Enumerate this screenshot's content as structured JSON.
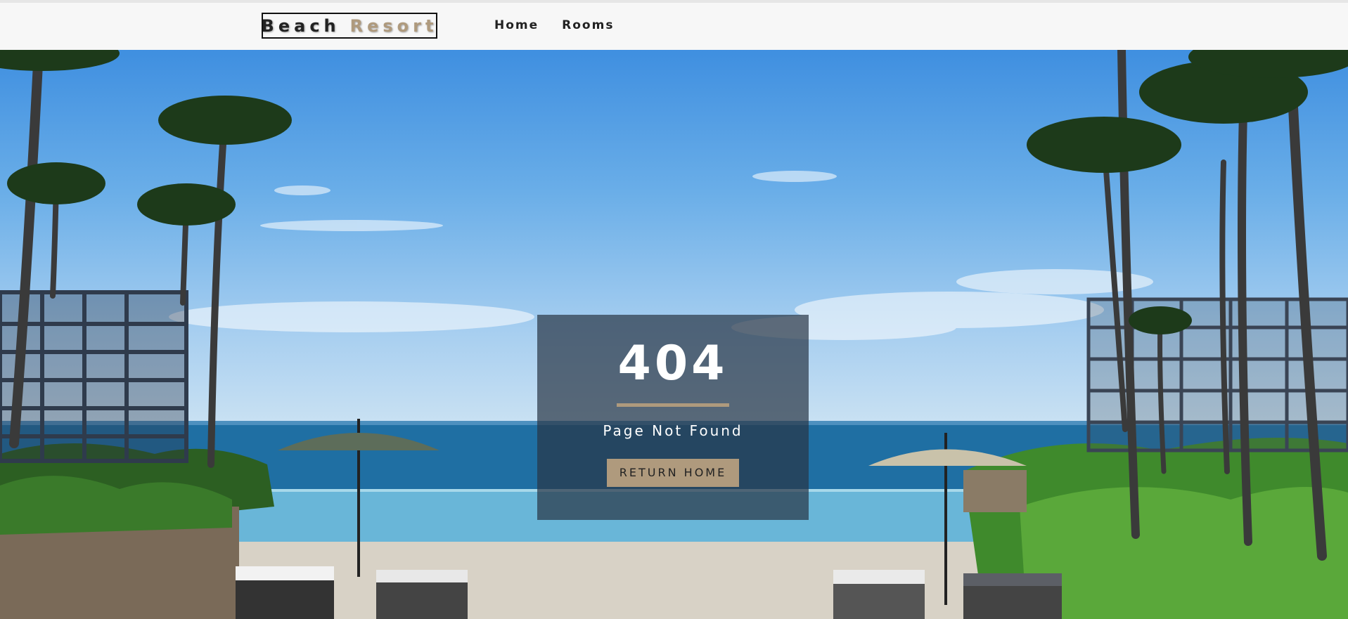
{
  "navbar": {
    "logo_word1": "Beach",
    "logo_word2": "Resort",
    "links": [
      {
        "label": "Home"
      },
      {
        "label": "Rooms"
      }
    ]
  },
  "banner": {
    "title": "404",
    "subtitle": "Page Not Found",
    "button_label": "return home"
  },
  "colors": {
    "accent": "#af9a7d",
    "navbar_bg": "#f7f7f7",
    "banner_overlay": "rgba(40,52,68,0.70)"
  }
}
